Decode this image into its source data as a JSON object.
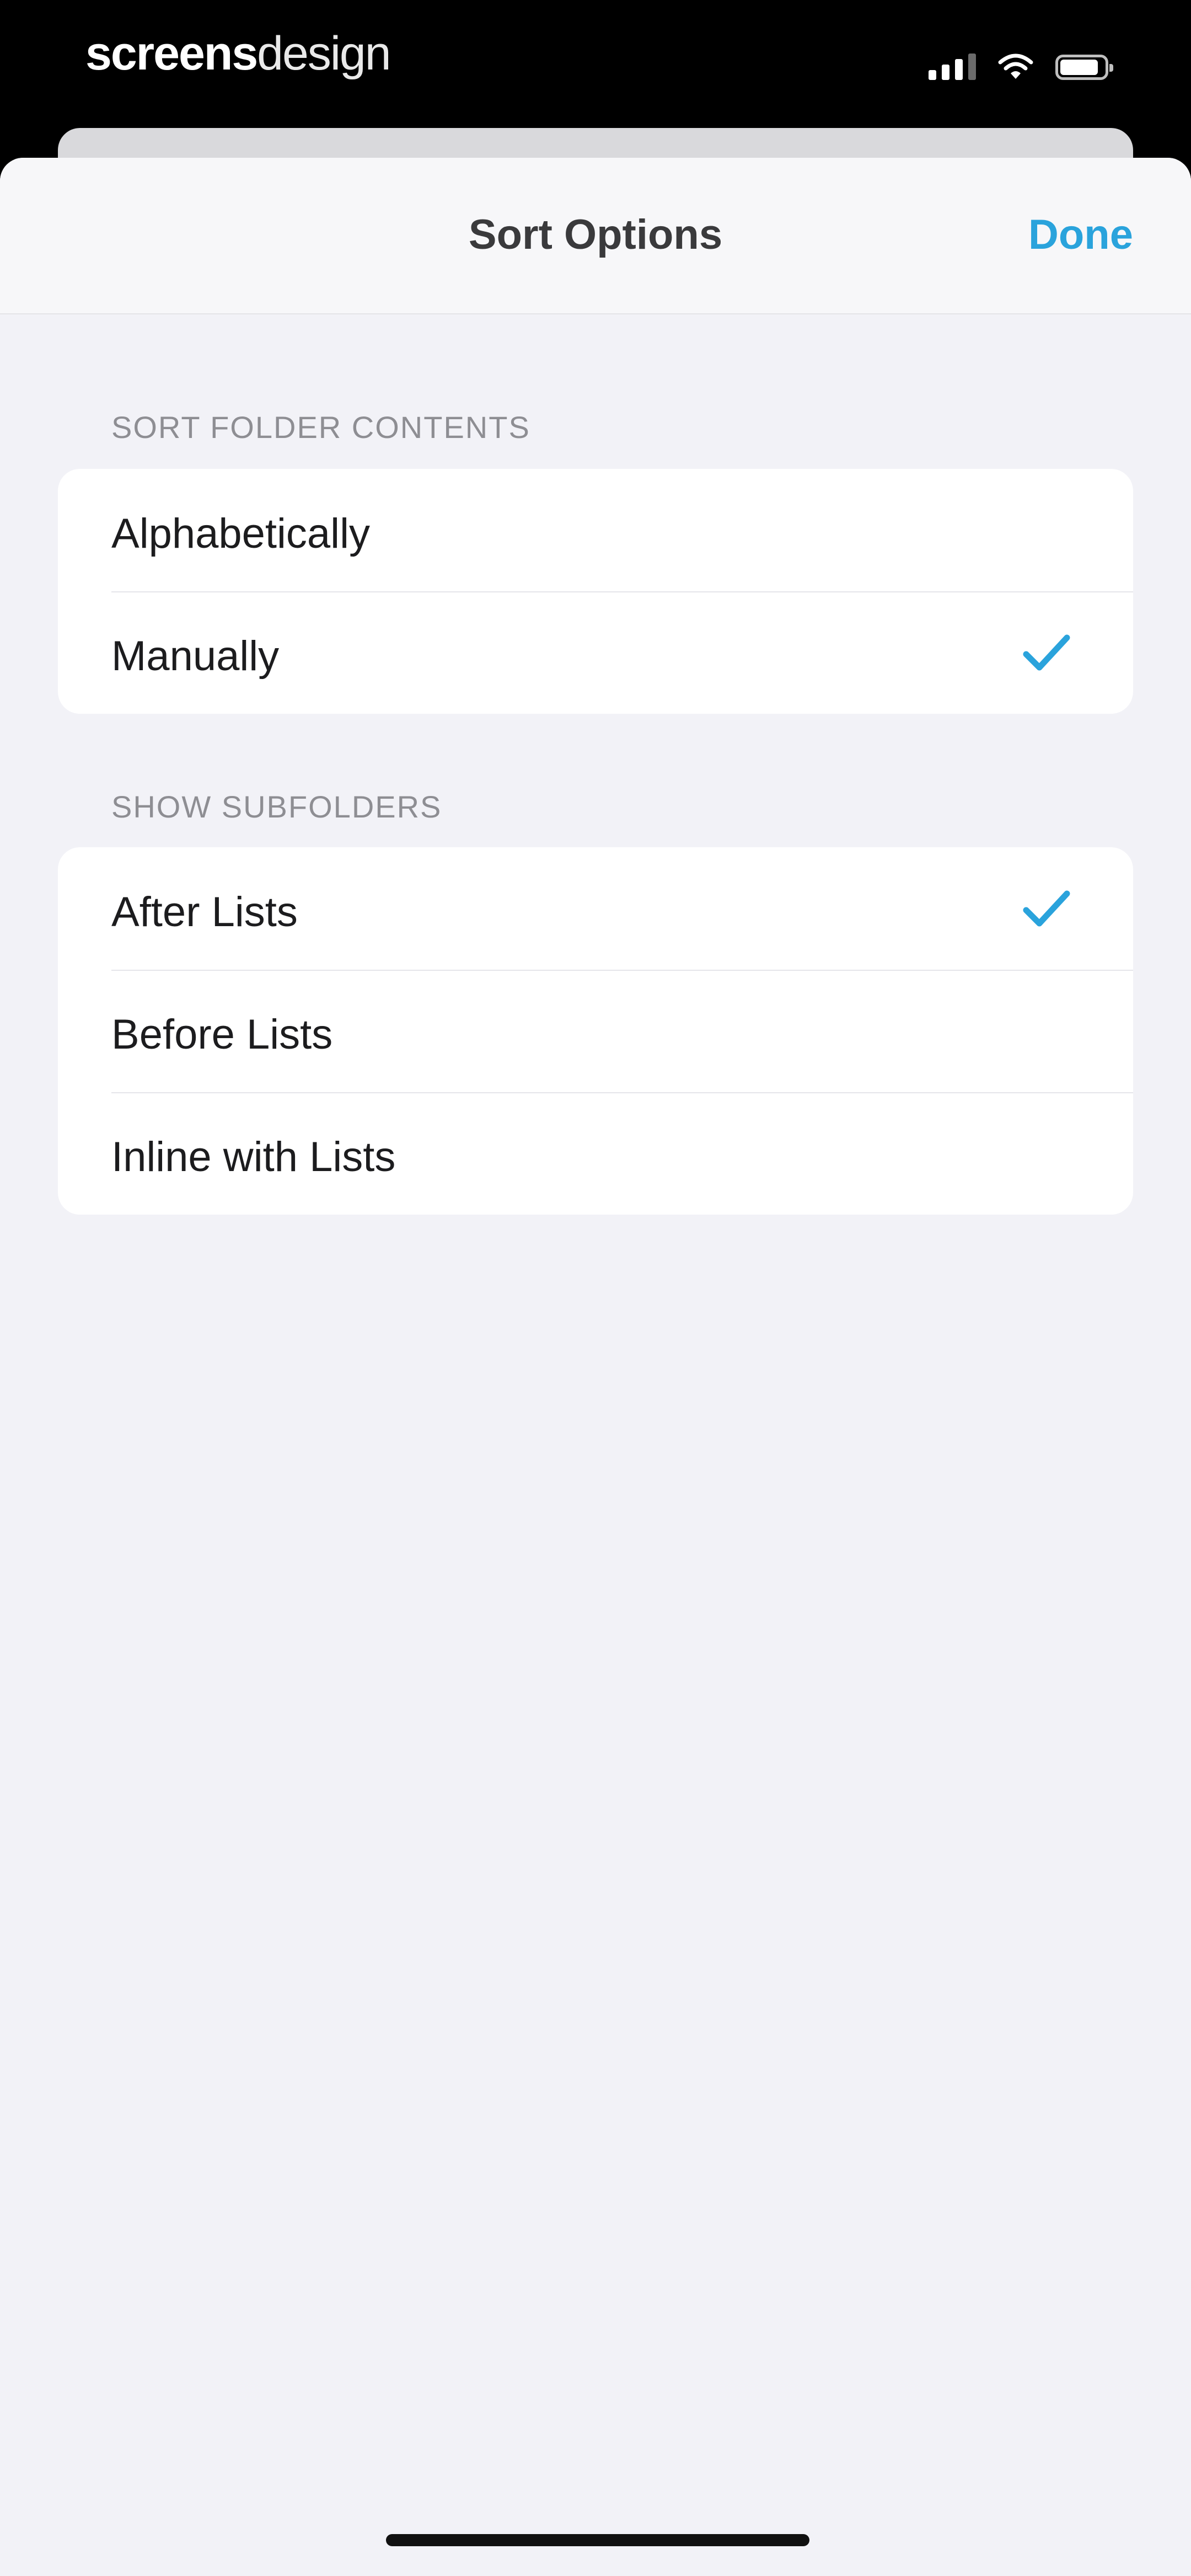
{
  "status_bar": {
    "brand_strong": "screens",
    "brand_light": "design",
    "icons": [
      "cellular-signal-icon",
      "wifi-icon",
      "battery-icon"
    ]
  },
  "nav": {
    "title": "Sort Options",
    "done_label": "Done"
  },
  "sections": [
    {
      "header": "SORT FOLDER CONTENTS",
      "rows": [
        {
          "label": "Alphabetically",
          "selected": false
        },
        {
          "label": "Manually",
          "selected": true
        }
      ]
    },
    {
      "header": "SHOW SUBFOLDERS",
      "rows": [
        {
          "label": "After Lists",
          "selected": true
        },
        {
          "label": "Before Lists",
          "selected": false
        },
        {
          "label": "Inline with Lists",
          "selected": false
        }
      ]
    }
  ],
  "colors": {
    "accent": "#2aa3dc",
    "background": "#f2f2f7",
    "row_background": "#ffffff"
  }
}
